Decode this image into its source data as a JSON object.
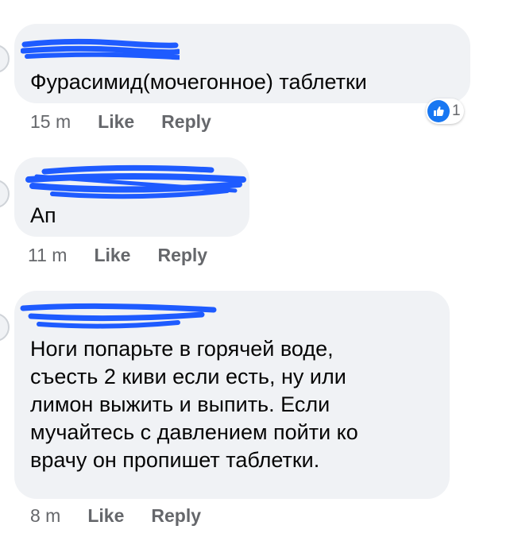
{
  "colors": {
    "bubble": "#f0f2f5",
    "text": "#050505",
    "meta": "#65676b",
    "redaction": "#1e5bff",
    "like_blue": "#1877f2"
  },
  "comments": [
    {
      "text": "Фурасимид(мочегонное) таблетки",
      "time": "15 m",
      "like_label": "Like",
      "reply_label": "Reply",
      "reaction": {
        "icon": "thumbs-up-icon",
        "count": "1"
      }
    },
    {
      "text": "Ап",
      "time": "11 m",
      "like_label": "Like",
      "reply_label": "Reply"
    },
    {
      "text": "Ноги попарьте в горячей воде,\nсъесть 2 киви если есть, ну или\nлимон выжить и выпить. Если\nмучайтесь с давлением пойти ко\nврачу он пропишет таблетки.",
      "time": "8 m",
      "like_label": "Like",
      "reply_label": "Reply"
    }
  ]
}
